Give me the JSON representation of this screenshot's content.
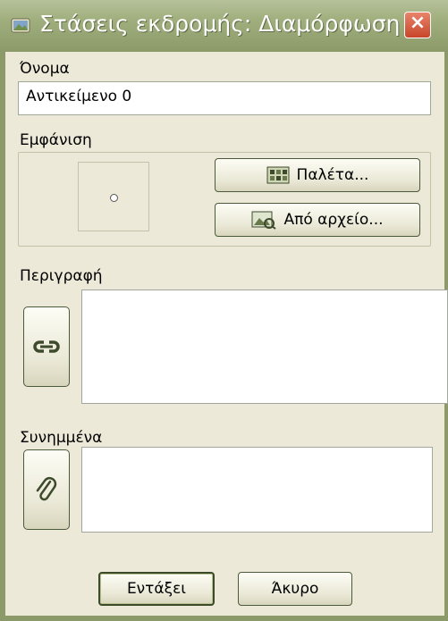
{
  "window": {
    "title": "Στάσεις εκδρομής: Διαμόρφωση",
    "close_label": "×"
  },
  "name_field": {
    "label": "Όνομα",
    "value": "Αντικείμενο 0"
  },
  "appearance": {
    "label": "Εμφάνιση",
    "palette_button": "Παλέτα...",
    "from_file_button": "Από αρχείο..."
  },
  "description": {
    "label": "Περιγραφή",
    "value": ""
  },
  "attachments": {
    "label": "Συνημμένα",
    "value": ""
  },
  "footer": {
    "ok_button": "Εντάξει",
    "cancel_button": "Άκυρο"
  },
  "icons": {
    "title": "window-app-icon",
    "palette": "palette-icon",
    "from_file": "image-file-icon",
    "link": "link-icon",
    "attach": "paperclip-icon"
  }
}
